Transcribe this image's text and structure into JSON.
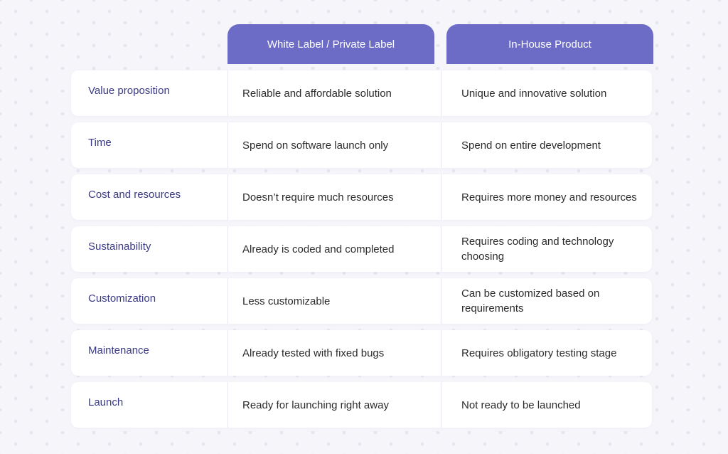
{
  "columns": [
    "White Label / Private Label",
    "In-House Product"
  ],
  "rows": [
    {
      "label": "Value proposition",
      "white_label": "Reliable and affordable solution",
      "in_house": "Unique and innovative solution"
    },
    {
      "label": "Time",
      "white_label": "Spend on software launch only",
      "in_house": "Spend on entire development"
    },
    {
      "label": "Cost and resources",
      "white_label": "Doesn’t require much resources",
      "in_house": "Requires more money and resources"
    },
    {
      "label": "Sustainability",
      "white_label": "Already is coded and completed",
      "in_house": "Requires coding and technology choosing"
    },
    {
      "label": "Customization",
      "white_label": "Less customizable",
      "in_house": "Can be customized based on requirements"
    },
    {
      "label": "Maintenance",
      "white_label": "Already tested with fixed bugs",
      "in_house": "Requires obligatory testing stage"
    },
    {
      "label": "Launch",
      "white_label": "Ready for launching right away",
      "in_house": "Not ready to be launched"
    }
  ],
  "colors": {
    "header": "#6c6cc7",
    "label": "#3b3b85",
    "text": "#2c2c2c",
    "background": "#f5f5fa"
  }
}
